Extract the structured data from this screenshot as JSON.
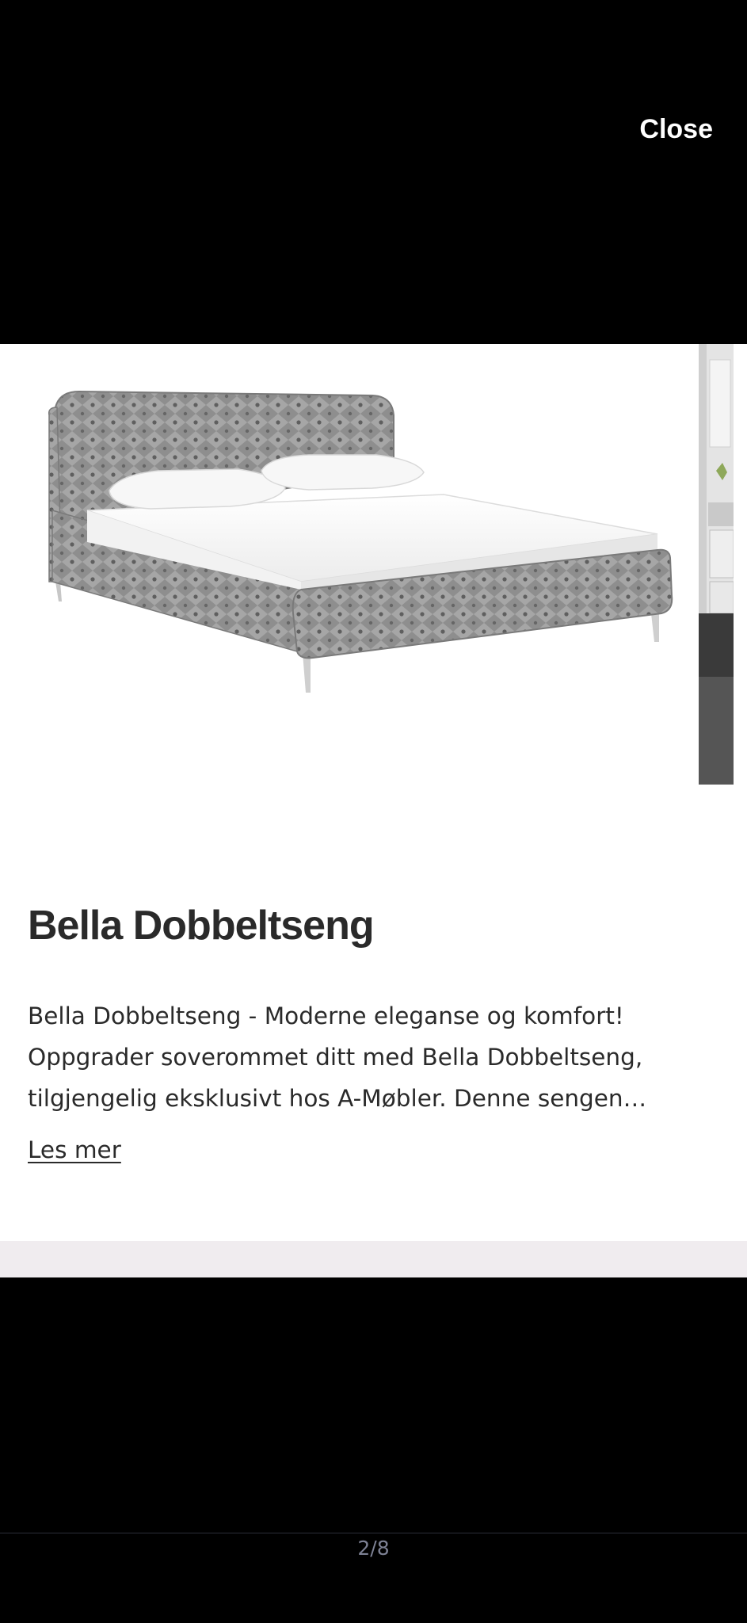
{
  "header": {
    "close_label": "Close"
  },
  "gallery": {
    "current_image": "bella-bed-grey-velvet",
    "next_image": "bedroom-scene"
  },
  "product": {
    "title": "Bella Dobbeltseng",
    "description": "Bella Dobbeltseng - Moderne eleganse og komfort! Oppgrader soverommet ditt med Bella Dobbeltseng, tilgjengelig eksklusivt hos A-Møbler. Denne sengen kommer med et elegant design.",
    "read_more_label": "Les mer"
  },
  "pager": {
    "indicator": "2/8"
  },
  "colors": {
    "backdrop": "#000000",
    "sheet": "#ffffff",
    "text": "#2a2a2a",
    "pager_text": "#7d8194",
    "bottom_strip": "#f0ecef"
  }
}
